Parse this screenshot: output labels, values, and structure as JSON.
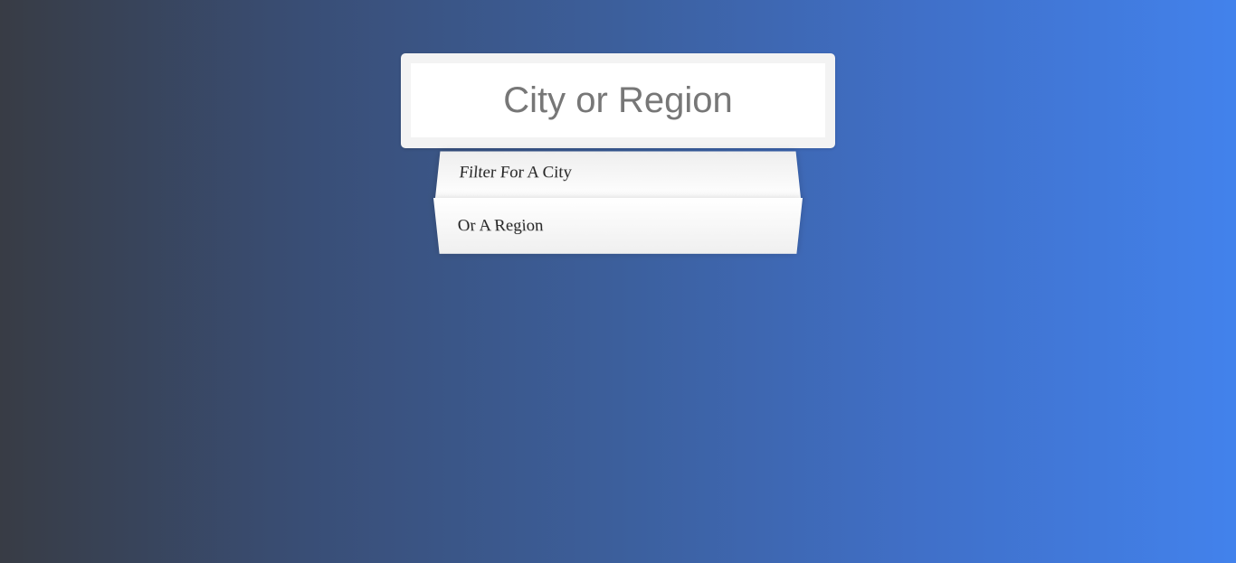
{
  "search": {
    "placeholder": "City or Region"
  },
  "suggestions": [
    {
      "label": "Filter For A City"
    },
    {
      "label": "Or A Region"
    }
  ],
  "colors": {
    "background_start": "#383c45",
    "background_end": "#4282ec",
    "panel": "#f3f3f3",
    "input_bg": "#ffffff",
    "placeholder": "#777777"
  }
}
